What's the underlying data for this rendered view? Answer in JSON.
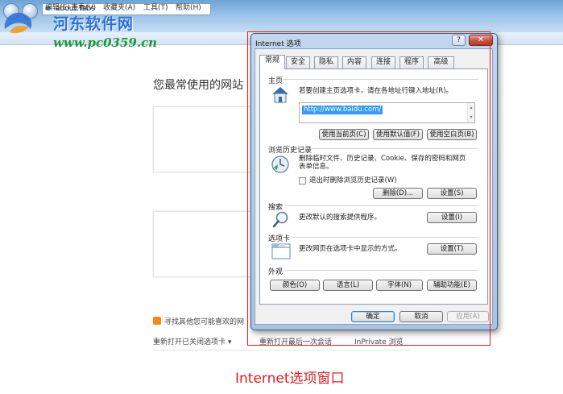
{
  "browser": {
    "address": "about:Tabs",
    "menu": [
      "编辑(E)",
      "查看(V)",
      "收藏夹(A)",
      "工具(T)",
      "帮助(H)"
    ],
    "heading": "您最常使用的网站",
    "discover_text": "寻找其他您可能喜欢的网",
    "bottom_links": [
      "重新打开已关闭选项卡 ▾",
      "重新打开最后一次会话",
      "InPrivate 浏览"
    ]
  },
  "watermark": {
    "title": "河东软件网",
    "url": "www.pc0359.cn"
  },
  "dialog": {
    "title": "Internet 选项",
    "help_label": "?",
    "close_label": "✕",
    "tabs": [
      "常规",
      "安全",
      "隐私",
      "内容",
      "连接",
      "程序",
      "高级"
    ],
    "home": {
      "label": "主页",
      "desc": "若要创建主页选项卡，请在各地址行键入地址(R)。",
      "url": "http://www.baidu.com/",
      "buttons": [
        "使用当前页(C)",
        "使用默认值(F)",
        "使用空白页(B)"
      ]
    },
    "history": {
      "label": "浏览历史记录",
      "desc_line1": "删除临时文件、历史记录、Cookie、保存的密码和网页",
      "desc_line2": "表单信息。",
      "checkbox_label": "退出时删除浏览历史记录(W)",
      "checkbox_checked": false,
      "delete_button": "删除(D)...",
      "settings_button": "设置(S)"
    },
    "search": {
      "label": "搜索",
      "desc": "更改默认的搜索提供程序。",
      "settings_button": "设置(I)"
    },
    "tabs_section": {
      "label": "选项卡",
      "desc": "更改网页在选项卡中显示的方式。",
      "settings_button": "设置(T)"
    },
    "appearance": {
      "label": "外观",
      "buttons": [
        "颜色(O)",
        "语言(L)",
        "字体(N)",
        "辅助功能(E)"
      ]
    },
    "footer": {
      "ok": "确定",
      "cancel": "取消",
      "apply": "应用(A)"
    }
  },
  "caption": "Internet选项窗口",
  "colors": {
    "annotation_red": "#e01e1e",
    "selection_blue": "#3399ff",
    "watermark_blue": "#2b6fd6",
    "watermark_green": "#1a9a3a"
  }
}
